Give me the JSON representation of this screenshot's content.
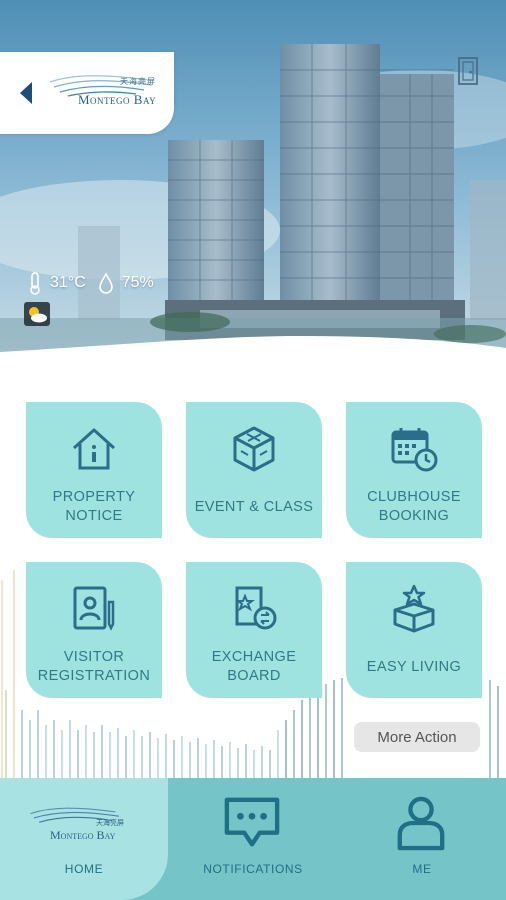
{
  "header": {
    "brand_zh": "天海亮屏",
    "brand_en": "Montego Bay",
    "back_icon": "back-arrow-icon",
    "door_icon": "door-icon"
  },
  "weather": {
    "temperature": "31°C",
    "humidity": "75%",
    "condition_icon": "partly-sunny-icon"
  },
  "tiles": [
    {
      "label": "PROPERTY NOTICE",
      "icon": "house-icon"
    },
    {
      "label": "EVENT & CLASS",
      "icon": "cube-icon"
    },
    {
      "label": "CLUBHOUSE BOOKING",
      "icon": "calendar-clock-icon"
    },
    {
      "label": "VISITOR REGISTRATION",
      "icon": "visitor-pass-icon"
    },
    {
      "label": "EXCHANGE BOARD",
      "icon": "exchange-icon"
    },
    {
      "label": "EASY LIVING",
      "icon": "gift-box-icon"
    }
  ],
  "more_action": "More Action",
  "nav": {
    "home": {
      "label": "HOME",
      "brand_zh": "天海亮屏",
      "brand_en": "Montego Bay"
    },
    "notifications": {
      "label": "NOTIFICATIONS"
    },
    "me": {
      "label": "ME"
    }
  },
  "colors": {
    "tile_bg": "#9fe3e0",
    "tile_text": "#2f7a86",
    "icon": "#2a6e8a",
    "nav_bg": "#75c5c8",
    "nav_active_bg": "#a9e2e3"
  }
}
